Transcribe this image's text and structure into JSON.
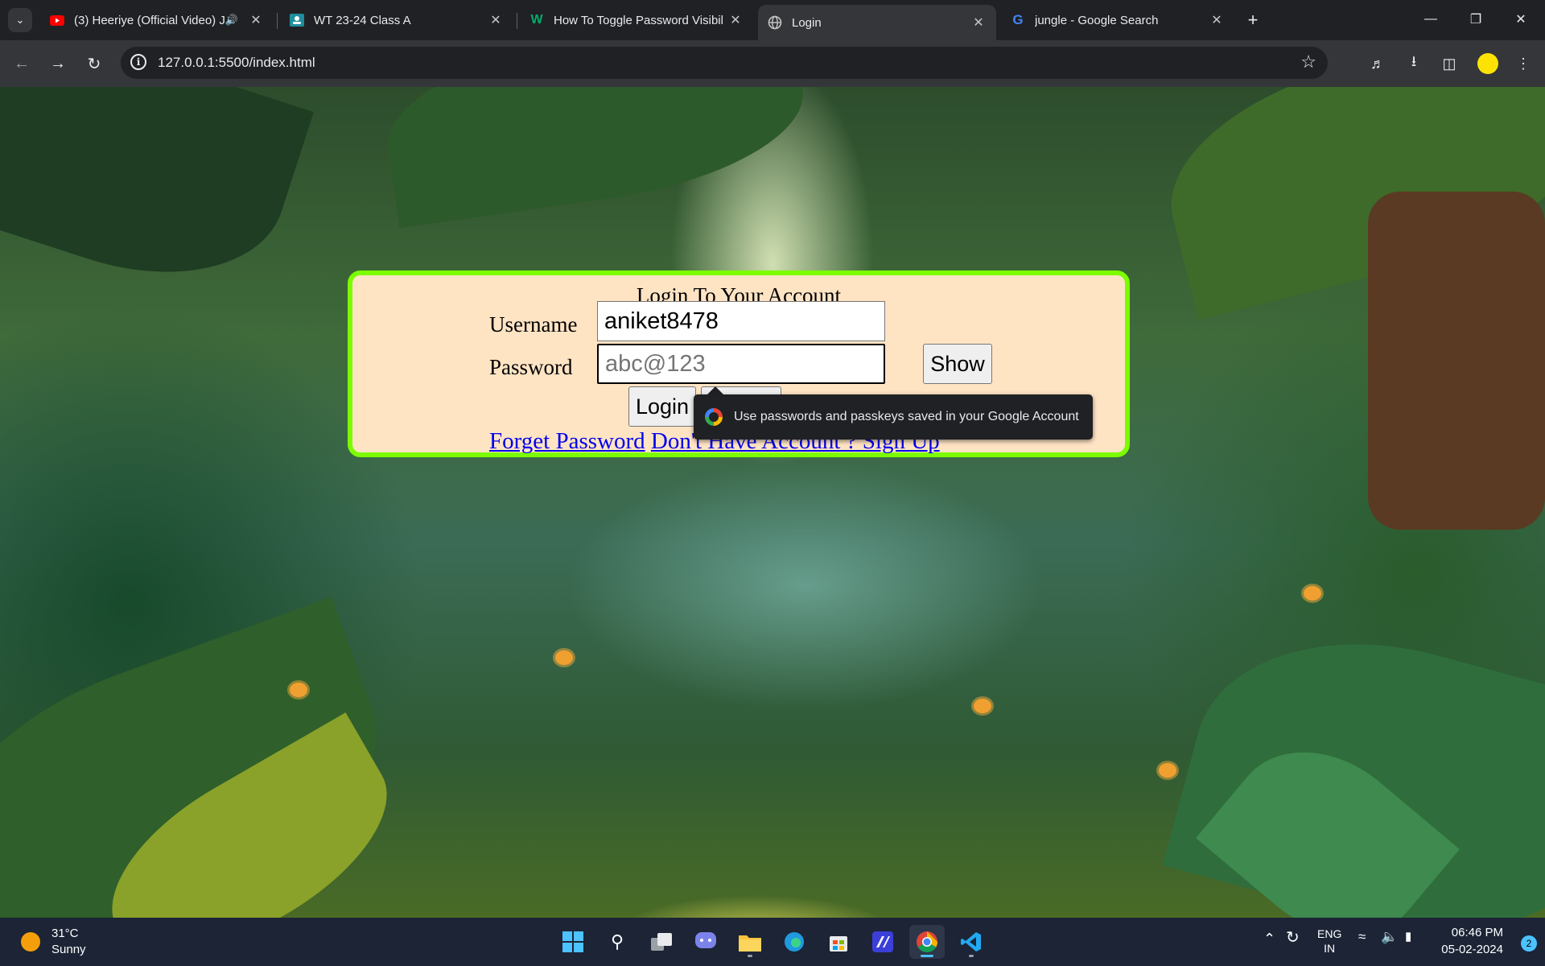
{
  "browser": {
    "tabs": [
      {
        "title": "(3) Heeriye (Official Video) J",
        "favicon": "youtube-icon",
        "audio": true,
        "active": false
      },
      {
        "title": "WT 23-24 Class A",
        "favicon": "classroom-icon",
        "audio": false,
        "active": false
      },
      {
        "title": "How To Toggle Password Visibil",
        "favicon": "w3-icon",
        "audio": false,
        "active": false
      },
      {
        "title": "Login",
        "favicon": "globe-icon",
        "audio": false,
        "active": true
      },
      {
        "title": "jungle - Google Search",
        "favicon": "google-icon",
        "audio": false,
        "active": false
      }
    ],
    "url": "127.0.0.1:5500/index.html",
    "profile_color": "#fde303"
  },
  "page": {
    "title": "Login To Your Account",
    "username_label": "Username",
    "username_value": "aniket8478",
    "password_label": "Password",
    "password_placeholder": "abc@123",
    "show_button": "Show",
    "login_button": "Login",
    "forget_password_link": "Forget Password",
    "signup_link": "Don't Have Account ? Sign Up",
    "card_border_color": "#7cfc00",
    "card_background": "#ffe4c4"
  },
  "autofill_tooltip": {
    "text": "Use passwords and passkeys saved in your Google Account"
  },
  "taskbar": {
    "weather_temp": "31°C",
    "weather_condition": "Sunny",
    "language_primary": "ENG",
    "language_secondary": "IN",
    "time": "06:46 PM",
    "date": "05-02-2024",
    "notification_count": "2"
  }
}
